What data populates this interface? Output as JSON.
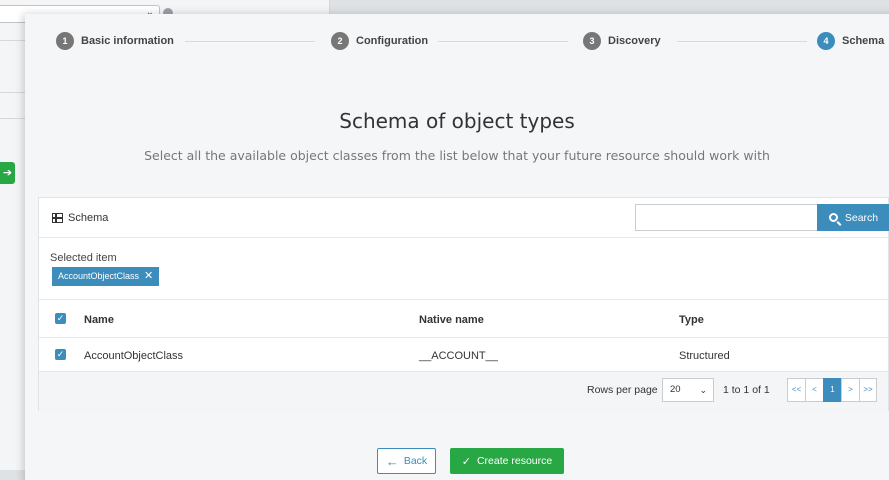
{
  "wizard": {
    "steps": [
      {
        "num": "1",
        "label": "Basic information"
      },
      {
        "num": "2",
        "label": "Configuration"
      },
      {
        "num": "3",
        "label": "Discovery"
      },
      {
        "num": "4",
        "label": "Schema"
      }
    ],
    "active_step": 4
  },
  "page": {
    "title": "Schema of object types",
    "subtitle": "Select all the available object classes from the list below that your future resource should work with"
  },
  "panel": {
    "title": "Schema",
    "search_placeholder": "",
    "search_label": "Search",
    "selected_label": "Selected item",
    "selected_items": [
      "AccountObjectClass"
    ]
  },
  "table": {
    "headers": {
      "name": "Name",
      "native_name": "Native name",
      "type": "Type"
    },
    "rows": [
      {
        "name": "AccountObjectClass",
        "native_name": "__ACCOUNT__",
        "type": "Structured",
        "checked": true
      }
    ]
  },
  "pagination": {
    "rows_per_page_label": "Rows per page",
    "rows_per_page": "20",
    "range": "1 to 1 of 1",
    "buttons": [
      "<<",
      "<",
      "1",
      ">",
      ">>"
    ]
  },
  "actions": {
    "back_label": "Back",
    "create_label": "Create resource"
  },
  "colors": {
    "primary": "#3c8dbc",
    "success": "#28a745"
  }
}
